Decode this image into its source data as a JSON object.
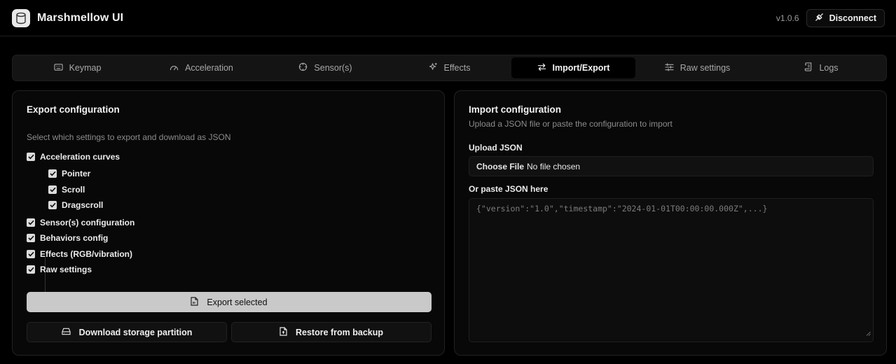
{
  "app": {
    "title": "Marshmellow UI",
    "version": "v1.0.6",
    "disconnect_label": "Disconnect"
  },
  "tabs": [
    {
      "label": "Keymap",
      "icon": "keyboard-icon"
    },
    {
      "label": "Acceleration",
      "icon": "gauge-icon"
    },
    {
      "label": "Sensor(s)",
      "icon": "crosshair-icon"
    },
    {
      "label": "Effects",
      "icon": "sparkles-icon"
    },
    {
      "label": "Import/Export",
      "icon": "arrows-swap-icon",
      "active": true
    },
    {
      "label": "Raw settings",
      "icon": "sliders-icon"
    },
    {
      "label": "Logs",
      "icon": "scroll-icon"
    }
  ],
  "export": {
    "title": "Export configuration",
    "description": "Select which settings to export and download as JSON",
    "options": [
      {
        "label": "Acceleration curves",
        "checked": true
      },
      {
        "label": "Pointer",
        "checked": true
      },
      {
        "label": "Scroll",
        "checked": true
      },
      {
        "label": "Dragscroll",
        "checked": true
      },
      {
        "label": "Sensor(s) configuration",
        "checked": true
      },
      {
        "label": "Behaviors config",
        "checked": true
      },
      {
        "label": "Effects (RGB/vibration)",
        "checked": true
      },
      {
        "label": "Raw settings",
        "checked": true
      }
    ],
    "export_button": "Export selected",
    "download_button": "Download storage partition",
    "restore_button": "Restore from backup"
  },
  "import": {
    "title": "Import configuration",
    "description": "Upload a JSON file or paste the configuration to import",
    "upload_label": "Upload JSON",
    "choose_file": "Choose File",
    "no_file": "No file chosen",
    "paste_label": "Or paste JSON here",
    "placeholder": "{\"version\":\"1.0\",\"timestamp\":\"2024-01-01T00:00:00.000Z\",...}"
  },
  "colors": {
    "background": "#000000",
    "card": "#080808",
    "export_button": "#c9c9c9",
    "active_tab": "#000000"
  }
}
